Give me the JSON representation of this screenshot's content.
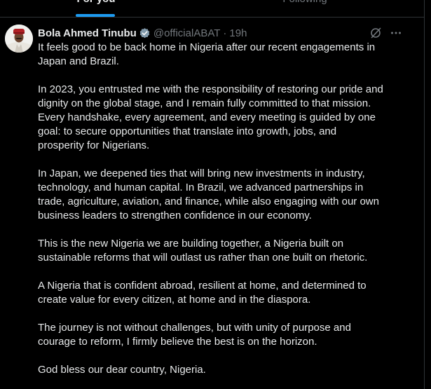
{
  "tabs": {
    "for_you": "For you",
    "following": "Following"
  },
  "post": {
    "author_name": "Bola Ahmed Tinubu",
    "handle": "@officialABAT",
    "separator": "·",
    "time": "19h",
    "verified_icon": "verified-badge-icon",
    "grok_icon": "grok-icon",
    "more_icon": "more-options-icon",
    "paragraphs": [
      "It feels good to be back home in Nigeria after our recent engagements in\nJapan and Brazil.",
      "In 2023, you entrusted me with the responsibility of restoring our pride and\ndignity on the global stage, and I remain fully committed to that mission.\nEvery handshake, every agreement, and every meeting is guided by one\ngoal: to secure opportunities that translate into growth, jobs, and\nprosperity for Nigerians.",
      "In Japan, we deepened ties that will bring new investments in industry,\ntechnology, and human capital. In Brazil, we advanced partnerships in\ntrade, agriculture, aviation, and finance, while also engaging with our own\nbusiness leaders to strengthen confidence in our economy.",
      "This is the new Nigeria we are building together, a Nigeria built on\nsustainable reforms that will outlast us rather than one built on rhetoric.",
      "A Nigeria that is confident abroad, resilient at home, and determined to\ncreate value for every citizen, at home and in the diaspora.",
      "The journey is not without challenges, but with unity of purpose and\ncourage to reform, I firmly believe the best is on the horizon.",
      "God bless our dear country, Nigeria."
    ]
  },
  "colors": {
    "background": "#000000",
    "text_primary": "#e7e9ea",
    "text_secondary": "#71767b",
    "accent": "#1d9bf0",
    "border": "#2f3336"
  }
}
